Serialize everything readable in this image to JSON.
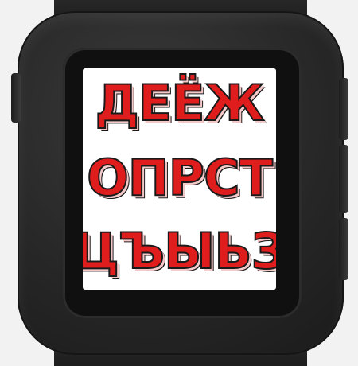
{
  "watch": {
    "screen": {
      "rows": [
        {
          "text": "ДЕЁЖ"
        },
        {
          "text": "ОПРСТ"
        },
        {
          "text": "ЦЪЫЬЗ"
        }
      ]
    }
  }
}
